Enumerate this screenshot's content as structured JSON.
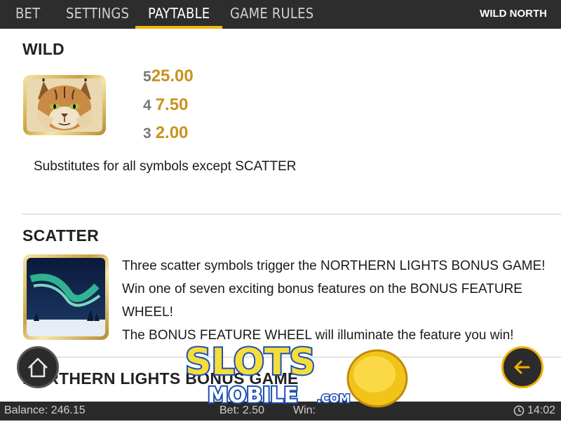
{
  "tabs": [
    {
      "label": "BET",
      "active": false
    },
    {
      "label": "SETTINGS",
      "active": false
    },
    {
      "label": "PAYTABLE",
      "active": true
    },
    {
      "label": "GAME RULES",
      "active": false
    }
  ],
  "game_title": "WILD NORTH",
  "wild": {
    "heading": "WILD",
    "payouts": [
      {
        "count": "5",
        "value": "25.00"
      },
      {
        "count": "4",
        "value": "7.50"
      },
      {
        "count": "3",
        "value": "2.00"
      }
    ],
    "description": "Substitutes for all symbols except SCATTER"
  },
  "scatter": {
    "heading": "SCATTER",
    "lines": [
      "Three scatter symbols trigger the NORTHERN LIGHTS BONUS GAME!",
      "Win one of seven exciting bonus features on the BONUS FEATURE",
      "WHEEL!",
      "The BONUS FEATURE WHEEL will illuminate the feature you win!"
    ]
  },
  "next_section_heading": "NORTHERN LIGHTS BONUS GAME",
  "bottom": {
    "balance": "Balance: 246.15",
    "bet": "Bet: 2.50",
    "win": "Win:",
    "time": "14:02"
  },
  "watermark": {
    "line1": "SLOTS",
    "line2": "MOBILE",
    "suffix": ".COM"
  },
  "colors": {
    "accent": "#f2b705",
    "topbar": "#2d2d2d",
    "payout_value": "#c9921a"
  }
}
